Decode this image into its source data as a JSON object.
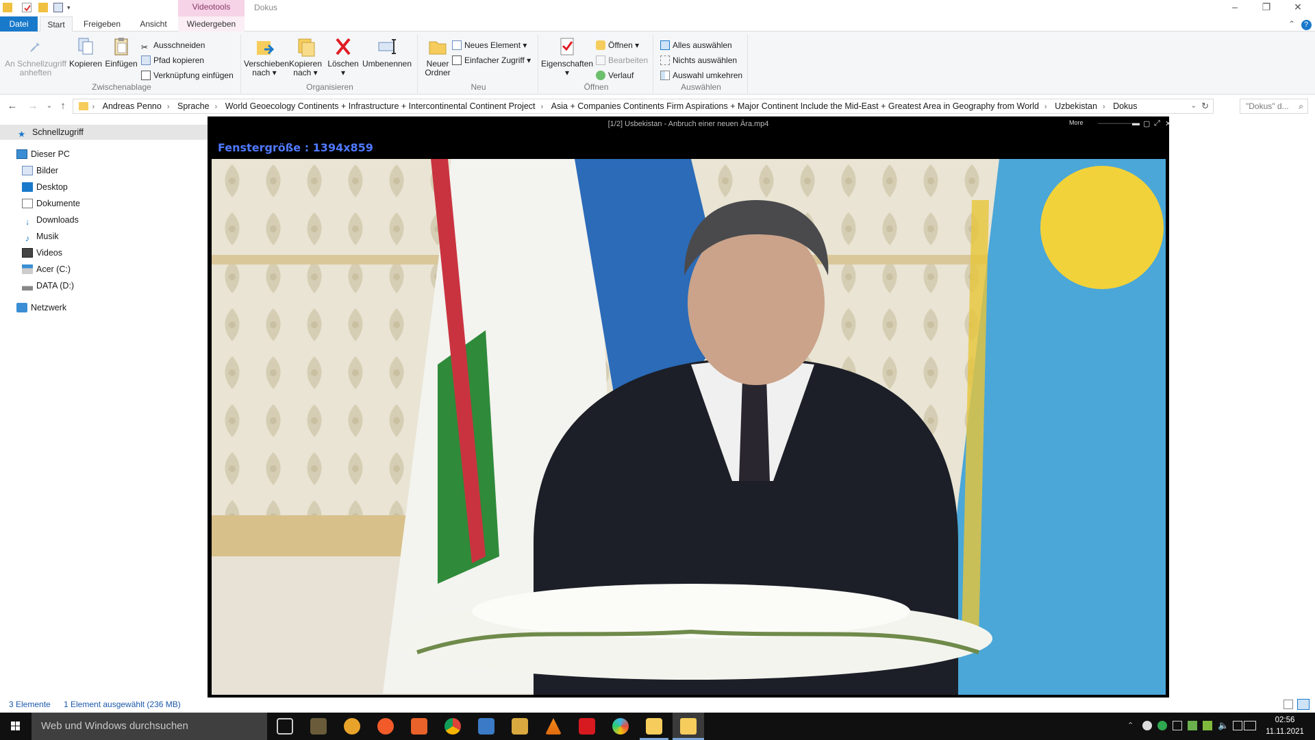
{
  "window": {
    "title": "Dokus",
    "context_tab": "Videotools"
  },
  "ribbon_tabs": {
    "file": "Datei",
    "start": "Start",
    "share": "Freigeben",
    "view": "Ansicht",
    "play": "Wiedergeben"
  },
  "ribbon": {
    "clipboard": {
      "label": "Zwischenablage",
      "pin": "An Schnellzugriff anheften",
      "copy": "Kopieren",
      "paste": "Einfügen",
      "cut": "Ausschneiden",
      "copy_path": "Pfad kopieren",
      "paste_shortcut": "Verknüpfung einfügen"
    },
    "organize": {
      "label": "Organisieren",
      "move_to": "Verschieben nach",
      "copy_to": "Kopieren nach",
      "delete": "Löschen",
      "rename": "Umbenennen"
    },
    "new": {
      "label": "Neu",
      "new_folder": "Neuer Ordner",
      "new_item": "Neues Element",
      "easy_access": "Einfacher Zugriff"
    },
    "open": {
      "label": "Öffnen",
      "properties": "Eigenschaften",
      "open": "Öffnen",
      "edit": "Bearbeiten",
      "history": "Verlauf"
    },
    "select": {
      "label": "Auswählen",
      "select_all": "Alles auswählen",
      "select_none": "Nichts auswählen",
      "invert": "Auswahl umkehren"
    }
  },
  "address": {
    "crumbs": [
      "Andreas Penno",
      "Sprache",
      "World Geoecology Continents + Infrastructure + Intercontinental Continent Project",
      "Asia + Companies  Continents Firm Aspirations + Major Continent Include the Mid-East + Greatest Area in Geography from World",
      "Uzbekistan",
      "Dokus"
    ],
    "search_placeholder": "\"Dokus\" d..."
  },
  "sidebar": {
    "quick_access": "Schnellzugriff",
    "this_pc": "Dieser PC",
    "items": [
      "Bilder",
      "Desktop",
      "Dokumente",
      "Downloads",
      "Musik",
      "Videos",
      "Acer (C:)",
      "DATA (D:)"
    ],
    "network": "Netzwerk"
  },
  "status": {
    "count": "3 Elemente",
    "selection": "1 Element ausgewählt (236 MB)"
  },
  "video": {
    "title": "[1/2] Usbekistan - Anbruch einer neuen Ära.mp4",
    "more": "More",
    "window_size": "Fenstergröße : 1394x859"
  },
  "taskbar": {
    "search": "Web und Windows durchsuchen",
    "time": "02:56",
    "date": "11.11.2021"
  }
}
